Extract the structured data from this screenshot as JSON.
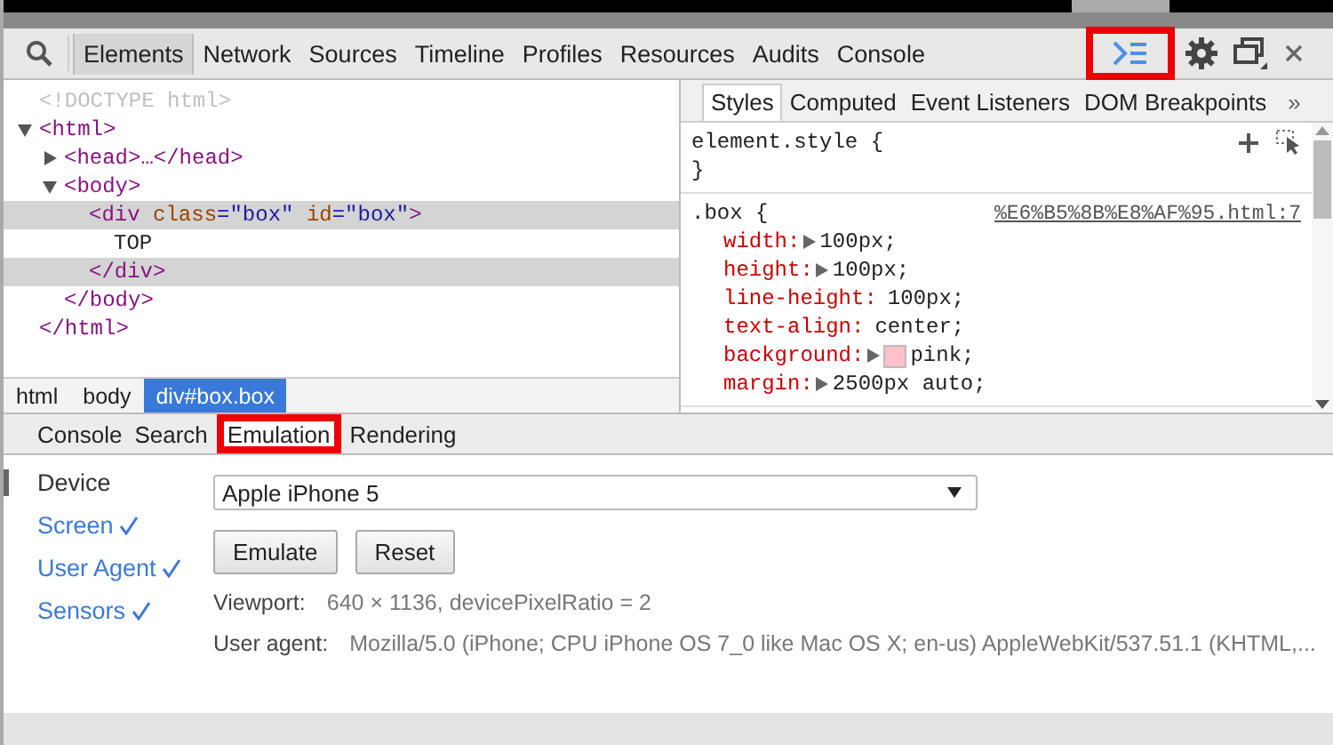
{
  "main_tabs": [
    {
      "label": "Elements",
      "selected": true
    },
    {
      "label": "Network",
      "selected": false
    },
    {
      "label": "Sources",
      "selected": false
    },
    {
      "label": "Timeline",
      "selected": false
    },
    {
      "label": "Profiles",
      "selected": false
    },
    {
      "label": "Resources",
      "selected": false
    },
    {
      "label": "Audits",
      "selected": false
    },
    {
      "label": "Console",
      "selected": false
    }
  ],
  "toolbar": {
    "drawer_button_highlighted": true
  },
  "dom_tree": [
    {
      "selected": false,
      "tokens": [
        {
          "kind": "doctype",
          "text": "<!DOCTYPE html>"
        }
      ]
    },
    {
      "expanded": true,
      "selected": false,
      "tokens": [
        {
          "kind": "tag",
          "text": "<html>"
        }
      ],
      "close": "</html>",
      "children": [
        {
          "expanded": false,
          "selected": false,
          "tokens": [
            {
              "kind": "tag",
              "text": "<head>…</head>"
            }
          ]
        },
        {
          "expanded": true,
          "selected": false,
          "tokens": [
            {
              "kind": "tag",
              "text": "<body>"
            }
          ],
          "close": "</body>",
          "children": [
            {
              "selected": true,
              "tokens": [
                {
                  "kind": "tag",
                  "text": "<div"
                },
                {
                  "kind": "attr-name",
                  "text": " class"
                },
                {
                  "kind": "attr-value",
                  "text": "=\"box\""
                },
                {
                  "kind": "attr-name",
                  "text": " id"
                },
                {
                  "kind": "attr-value",
                  "text": "=\"box\""
                },
                {
                  "kind": "tag",
                  "text": ">"
                }
              ],
              "close": "</div>",
              "children": [
                {
                  "selected": false,
                  "tokens": [
                    {
                      "kind": "text",
                      "text": "TOP"
                    }
                  ]
                }
              ]
            }
          ]
        }
      ]
    }
  ],
  "breadcrumbs": [
    {
      "label": "html",
      "selected": false
    },
    {
      "label": "body",
      "selected": false
    },
    {
      "label": "div#box.box",
      "selected": true
    }
  ],
  "sidebar_tabs": [
    {
      "label": "Styles",
      "selected": true
    },
    {
      "label": "Computed",
      "selected": false
    },
    {
      "label": "Event Listeners",
      "selected": false
    },
    {
      "label": "DOM Breakpoints",
      "selected": false
    }
  ],
  "sidebar_more": "»",
  "style_rules": [
    {
      "selector": "element.style {",
      "close": "}",
      "tools": true
    },
    {
      "selector": ".box {",
      "source": "%E6%B5%8B%E8%AF%95.html:7",
      "tools": false,
      "properties": [
        {
          "name": "width:",
          "expandable": true,
          "value": "100px;"
        },
        {
          "name": "height:",
          "expandable": true,
          "value": "100px;"
        },
        {
          "name": "line-height:",
          "expandable": false,
          "value": "100px;"
        },
        {
          "name": "text-align:",
          "expandable": false,
          "value": "center;"
        },
        {
          "name": "background:",
          "expandable": true,
          "color": "#ffc0cb",
          "value": "pink;"
        },
        {
          "name": "margin:",
          "expandable": true,
          "value": "2500px auto;"
        }
      ]
    }
  ],
  "drawer_tabs": [
    {
      "label": "Console",
      "selected": false,
      "highlighted": false
    },
    {
      "label": "Search",
      "selected": false,
      "highlighted": false
    },
    {
      "label": "Emulation",
      "selected": true,
      "highlighted": true
    },
    {
      "label": "Rendering",
      "selected": false,
      "highlighted": false
    }
  ],
  "emulation_sections": [
    {
      "label": "Device",
      "selected": true,
      "checked": false
    },
    {
      "label": "Screen",
      "selected": false,
      "checked": true
    },
    {
      "label": "User Agent",
      "selected": false,
      "checked": true
    },
    {
      "label": "Sensors",
      "selected": false,
      "checked": true
    }
  ],
  "device": {
    "value": "Apple iPhone 5"
  },
  "buttons": [
    "Emulate",
    "Reset"
  ],
  "info": [
    {
      "label": "Viewport:",
      "value": "640 × 1136, devicePixelRatio = 2"
    },
    {
      "label": "User agent:",
      "value": "Mozilla/5.0 (iPhone; CPU iPhone OS 7_0 like Mac OS X; en-us) AppleWebKit/537.51.1 (KHTML,..."
    }
  ]
}
